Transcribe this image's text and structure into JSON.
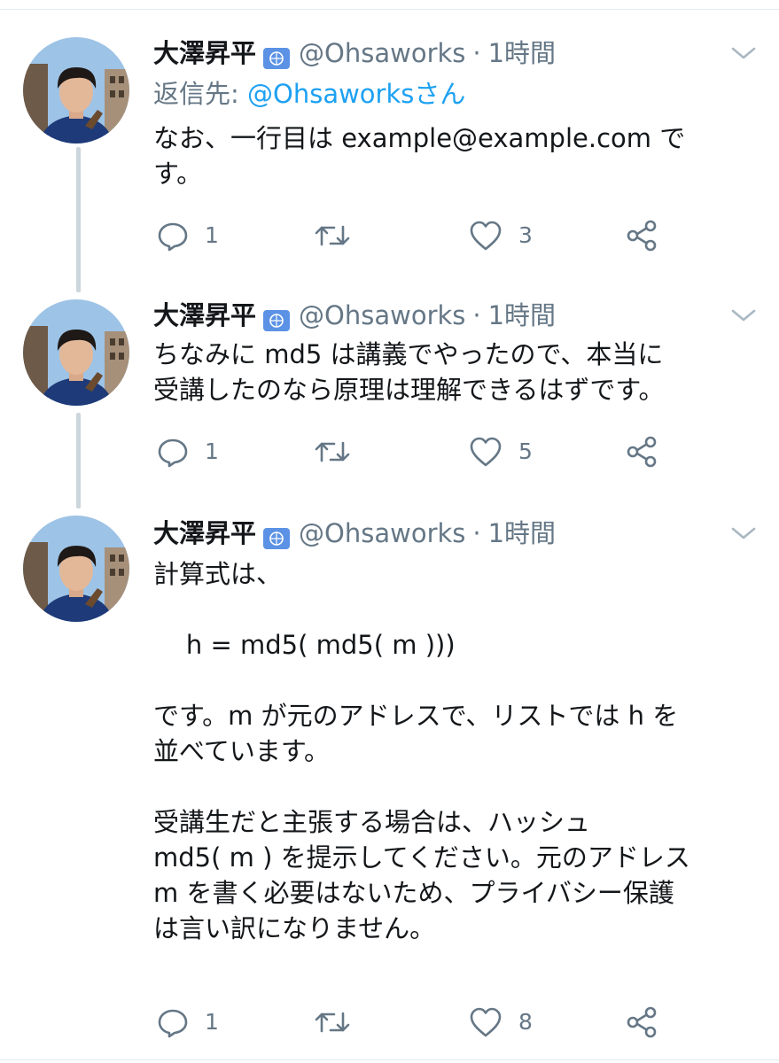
{
  "tweets": [
    {
      "display_name": "大澤昇平",
      "handle": "@Ohsaworks",
      "separator": "·",
      "time": "1時間",
      "reply_prefix": "返信先:",
      "reply_handle": "@Ohsaworksさん",
      "text": "なお、一行目は example@example.com で\nす。",
      "replies": "1",
      "retweets": "",
      "likes": "3"
    },
    {
      "display_name": "大澤昇平",
      "handle": "@Ohsaworks",
      "separator": "·",
      "time": "1時間",
      "text": "ちなみに md5 は講義でやったので、本当に\n受講したのなら原理は理解できるはずです。",
      "replies": "1",
      "retweets": "",
      "likes": "5"
    },
    {
      "display_name": "大澤昇平",
      "handle": "@Ohsaworks",
      "separator": "·",
      "time": "1時間",
      "text": "計算式は、\n\n    h = md5( md5( m )))\n\nです。m が元のアドレスで、リストでは h を\n並べています。\n\n受講生だと主張する場合は、ハッシュ\nmd5( m ) を提示してください。元のアドレス\nm を書く必要はないため、プライバシー保護\nは言い訳になりません。",
      "replies": "1",
      "retweets": "",
      "likes": "8"
    }
  ],
  "icons": {
    "reply": "speech-bubble-icon",
    "retweet": "retweet-arrows-icon",
    "like": "heart-icon",
    "share": "share-icon",
    "menu": "chevron-down-icon",
    "badge": "un-emblem-icon"
  },
  "colors": {
    "text": "#14171a",
    "muted": "#657786",
    "link": "#1da1f2",
    "thread_line": "#ccd6dd",
    "badge": "#5b92e5"
  }
}
